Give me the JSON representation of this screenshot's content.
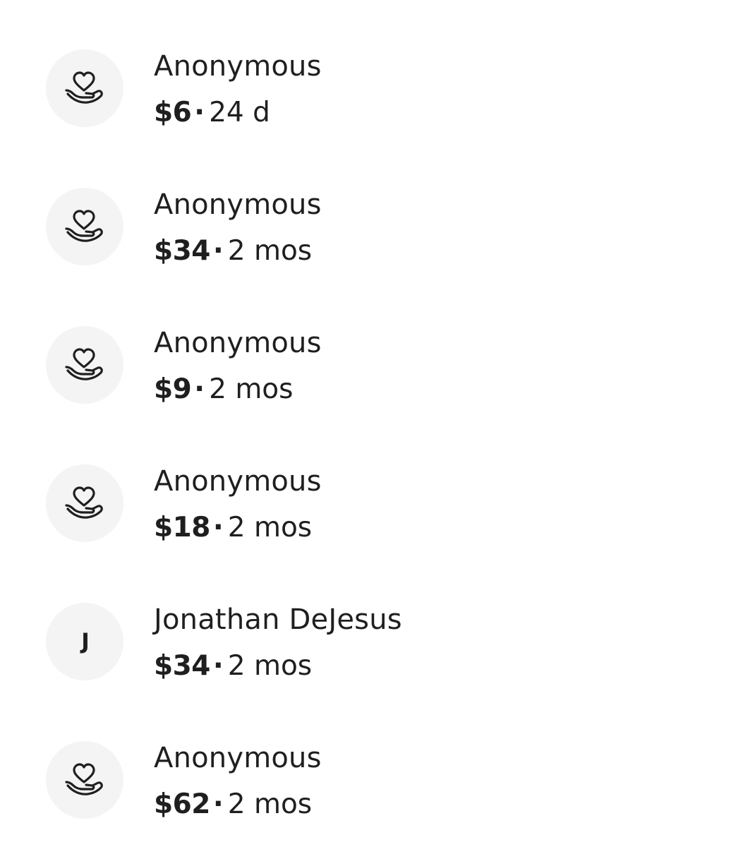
{
  "donations": [
    {
      "avatar": "hand-heart-icon",
      "initial": "",
      "name": "Anonymous",
      "amount": "$6",
      "separator": "·",
      "time": "24 d"
    },
    {
      "avatar": "hand-heart-icon",
      "initial": "",
      "name": "Anonymous",
      "amount": "$34",
      "separator": "·",
      "time": "2 mos"
    },
    {
      "avatar": "hand-heart-icon",
      "initial": "",
      "name": "Anonymous",
      "amount": "$9",
      "separator": "·",
      "time": "2 mos"
    },
    {
      "avatar": "hand-heart-icon",
      "initial": "",
      "name": "Anonymous",
      "amount": "$18",
      "separator": "·",
      "time": "2 mos"
    },
    {
      "avatar": "initial",
      "initial": "J",
      "name": "Jonathan DeJesus",
      "amount": "$34",
      "separator": "·",
      "time": "2 mos"
    },
    {
      "avatar": "hand-heart-icon",
      "initial": "",
      "name": "Anonymous",
      "amount": "$62",
      "separator": "·",
      "time": "2 mos"
    }
  ]
}
